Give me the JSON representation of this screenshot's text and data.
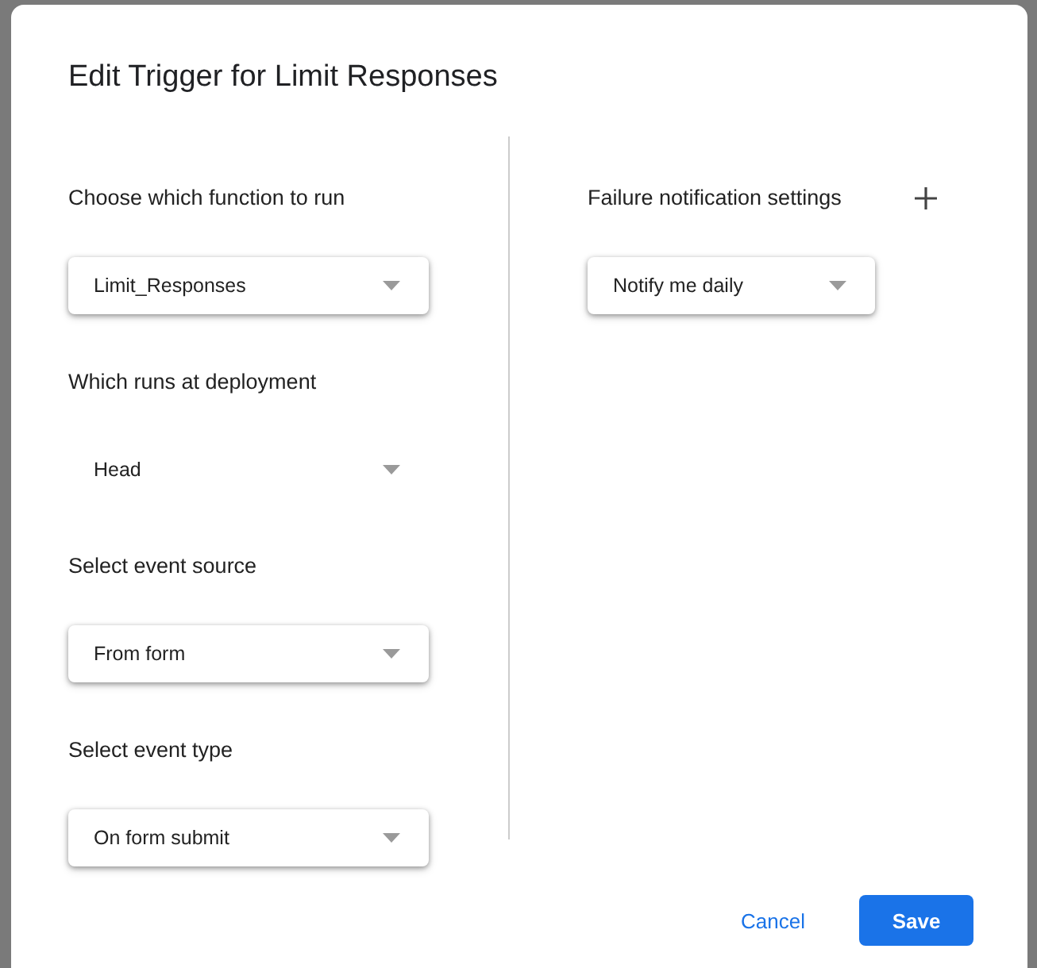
{
  "dialog": {
    "title": "Edit Trigger for Limit Responses",
    "fields": [
      {
        "label": "Choose which function to run",
        "value": "Limit_Responses",
        "disabled": false
      },
      {
        "label": "Which runs at deployment",
        "value": "Head",
        "disabled": true
      },
      {
        "label": "Select event source",
        "value": "From form",
        "disabled": false
      },
      {
        "label": "Select event type",
        "value": "On form submit",
        "disabled": false
      }
    ],
    "failure_notification": {
      "label": "Failure notification settings",
      "value": "Notify me daily",
      "disabled": false
    },
    "buttons": [
      {
        "label": "Cancel",
        "kind": "text"
      },
      {
        "label": "Save",
        "kind": "primary"
      }
    ]
  }
}
